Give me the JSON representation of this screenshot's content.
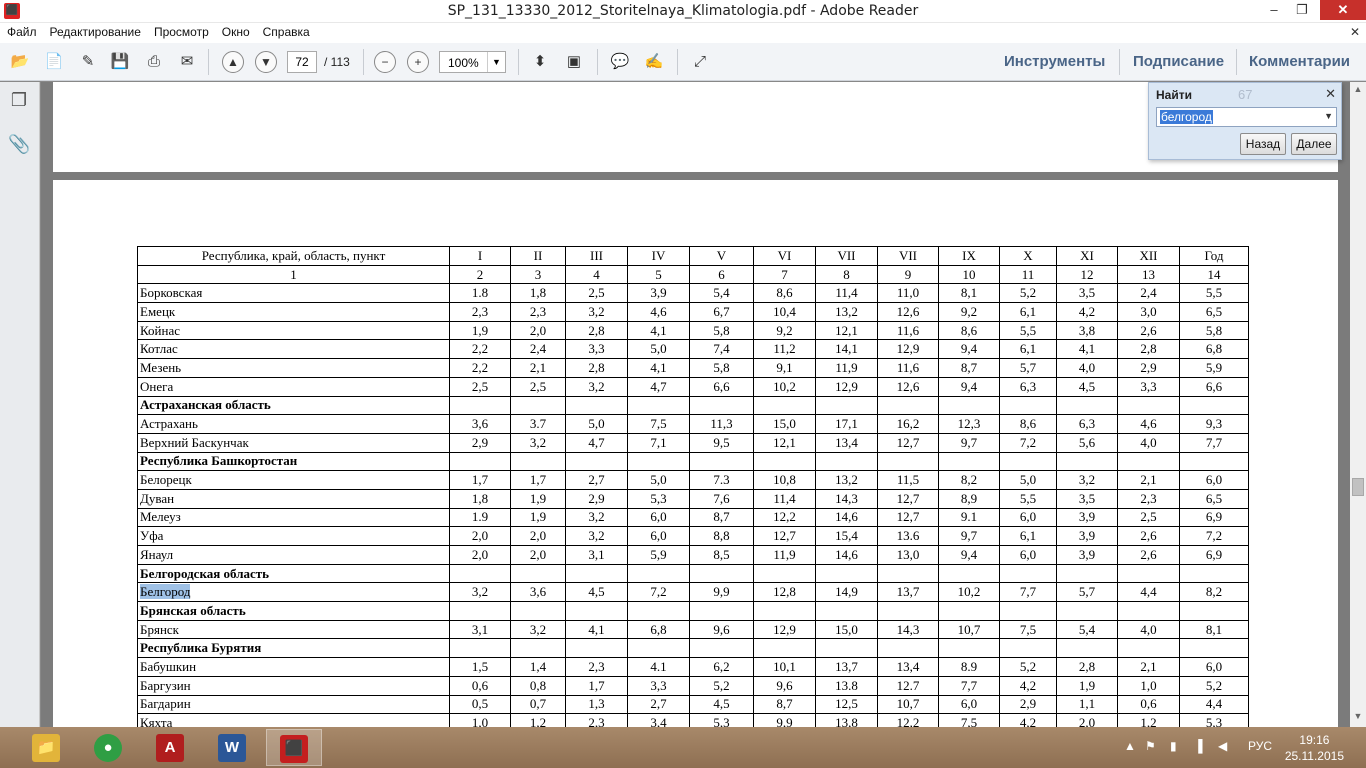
{
  "window": {
    "title": "SP_131_13330_2012_Storitelnaya_Klimatologia.pdf - Adobe Reader",
    "min": "–",
    "max": "❐",
    "close": "✕"
  },
  "menu": {
    "items": [
      "Файл",
      "Редактирование",
      "Просмотр",
      "Окно",
      "Справка"
    ],
    "close": "✕"
  },
  "toolbar": {
    "page_current": "72",
    "page_total": "/ 113",
    "zoom": "100%",
    "tabs": [
      "Инструменты",
      "Подписание",
      "Комментарии"
    ]
  },
  "find": {
    "label": "Найти",
    "count": "67",
    "query": "белгород",
    "back": "Назад",
    "next": "Далее"
  },
  "table": {
    "headers": [
      "Республика, край, область, пункт",
      "I",
      "II",
      "III",
      "IV",
      "V",
      "VI",
      "VII",
      "VII",
      "IX",
      "X",
      "XI",
      "XII",
      "Год"
    ],
    "col_numbers": [
      "1",
      "2",
      "3",
      "4",
      "5",
      "6",
      "7",
      "8",
      "9",
      "10",
      "11",
      "12",
      "13",
      "14"
    ],
    "rows": [
      {
        "name": "Борковская",
        "values": [
          "1.8",
          "1,8",
          "2,5",
          "3,9",
          "5,4",
          "8,6",
          "11,4",
          "11,0",
          "8,1",
          "5,2",
          "3,5",
          "2,4",
          "5,5"
        ]
      },
      {
        "name": "Емецк",
        "values": [
          "2,3",
          "2,3",
          "3,2",
          "4,6",
          "6,7",
          "10,4",
          "13,2",
          "12,6",
          "9,2",
          "6,1",
          "4,2",
          "3,0",
          "6,5"
        ]
      },
      {
        "name": "Койнас",
        "values": [
          "1,9",
          "2,0",
          "2,8",
          "4,1",
          "5,8",
          "9,2",
          "12,1",
          "11,6",
          "8,6",
          "5,5",
          "3,8",
          "2,6",
          "5,8"
        ]
      },
      {
        "name": "Котлас",
        "values": [
          "2,2",
          "2,4",
          "3,3",
          "5,0",
          "7,4",
          "11,2",
          "14,1",
          "12,9",
          "9,4",
          "6,1",
          "4,1",
          "2,8",
          "6,8"
        ]
      },
      {
        "name": "Мезень",
        "values": [
          "2,2",
          "2,1",
          "2,8",
          "4,1",
          "5,8",
          "9,1",
          "11,9",
          "11,6",
          "8,7",
          "5,7",
          "4,0",
          "2,9",
          "5,9"
        ]
      },
      {
        "name": "Онега",
        "values": [
          "2,5",
          "2,5",
          "3,2",
          "4,7",
          "6,6",
          "10,2",
          "12,9",
          "12,6",
          "9,4",
          "6,3",
          "4,5",
          "3,3",
          "6,6"
        ]
      },
      {
        "name": "Астраханская область",
        "region": true
      },
      {
        "name": "Астрахань",
        "values": [
          "3,6",
          "3.7",
          "5,0",
          "7,5",
          "11,3",
          "15,0",
          "17,1",
          "16,2",
          "12,3",
          "8,6",
          "6,3",
          "4,6",
          "9,3"
        ]
      },
      {
        "name": "Верхний Баскунчак",
        "values": [
          "2,9",
          "3,2",
          "4,7",
          "7,1",
          "9,5",
          "12,1",
          "13,4",
          "12,7",
          "9,7",
          "7,2",
          "5,6",
          "4,0",
          "7,7"
        ]
      },
      {
        "name": "Республика Башкортостан",
        "region": true
      },
      {
        "name": "Белорецк",
        "values": [
          "1,7",
          "1,7",
          "2,7",
          "5,0",
          "7.3",
          "10,8",
          "13,2",
          "11,5",
          "8,2",
          "5,0",
          "3,2",
          "2,1",
          "6,0"
        ]
      },
      {
        "name": "Дуван",
        "values": [
          "1,8",
          "1,9",
          "2,9",
          "5,3",
          "7,6",
          "11,4",
          "14,3",
          "12,7",
          "8,9",
          "5,5",
          "3,5",
          "2,3",
          "6,5"
        ]
      },
      {
        "name": "Мелеуз",
        "values": [
          "1.9",
          "1,9",
          "3,2",
          "6,0",
          "8,7",
          "12,2",
          "14,6",
          "12,7",
          "9.1",
          "6,0",
          "3,9",
          "2,5",
          "6,9"
        ]
      },
      {
        "name": "Уфа",
        "values": [
          "2,0",
          "2,0",
          "3,2",
          "6,0",
          "8,8",
          "12,7",
          "15,4",
          "13.6",
          "9,7",
          "6,1",
          "3,9",
          "2,6",
          "7,2"
        ]
      },
      {
        "name": "Янаул",
        "values": [
          "2,0",
          "2,0",
          "3,1",
          "5,9",
          "8,5",
          "11,9",
          "14,6",
          "13,0",
          "9,4",
          "6,0",
          "3,9",
          "2,6",
          "6,9"
        ]
      },
      {
        "name": "Белгородская область",
        "region": true
      },
      {
        "name": "Белгород",
        "highlight": true,
        "values": [
          "3,2",
          "3,6",
          "4,5",
          "7,2",
          "9,9",
          "12,8",
          "14,9",
          "13,7",
          "10,2",
          "7,7",
          "5,7",
          "4,4",
          "8,2"
        ]
      },
      {
        "name": "Брянская область",
        "region": true
      },
      {
        "name": "Брянск",
        "values": [
          "3,1",
          "3,2",
          "4,1",
          "6,8",
          "9,6",
          "12,9",
          "15,0",
          "14,3",
          "10,7",
          "7,5",
          "5,4",
          "4,0",
          "8,1"
        ]
      },
      {
        "name": "Республика Бурятия",
        "region": true
      },
      {
        "name": "Бабушкин",
        "values": [
          "1,5",
          "1,4",
          "2,3",
          "4.1",
          "6,2",
          "10,1",
          "13,7",
          "13,4",
          "8.9",
          "5,2",
          "2,8",
          "2,1",
          "6,0"
        ]
      },
      {
        "name": "Баргузин",
        "values": [
          "0,6",
          "0,8",
          "1,7",
          "3,3",
          "5,2",
          "9,6",
          "13.8",
          "12.7",
          "7,7",
          "4,2",
          "1,9",
          "1,0",
          "5,2"
        ]
      },
      {
        "name": "Багдарин",
        "values": [
          "0,5",
          "0,7",
          "1,3",
          "2,7",
          "4,5",
          "8,7",
          "12,5",
          "10,7",
          "6,0",
          "2,9",
          "1,1",
          "0,6",
          "4,4"
        ]
      },
      {
        "name": "Кяхта",
        "values": [
          "1,0",
          "1,2",
          "2,3",
          "3,4",
          "5,3",
          "9,9",
          "13,8",
          "12,2",
          "7,5",
          "4,2",
          "2,0",
          "1,2",
          "5,3"
        ]
      }
    ]
  },
  "taskbar": {
    "language": "РУС",
    "time": "19:16",
    "date": "25.11.2015"
  },
  "icons": {
    "tray_up": "up-arrow-icon",
    "flag": "flag-icon",
    "battery": "battery-icon",
    "signal": "signal-icon",
    "volume": "volume-icon"
  },
  "colors": {
    "highlight": "#9fc1e6",
    "tab_text": "#4a6587",
    "close_button": "#c7302b"
  }
}
